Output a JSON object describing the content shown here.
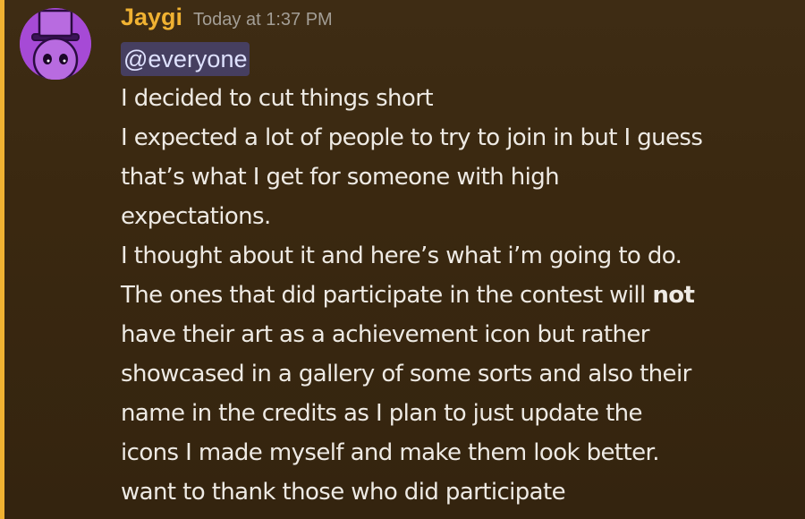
{
  "message": {
    "author": "Jaygi",
    "timestamp": "Today at 1:37 PM",
    "mention": "@everyone",
    "lines": [
      "I decided to cut things short",
      "I expected a lot of people to try to join in but I guess",
      "that’s what I get for someone with high",
      "expectations.",
      "I thought about it and here’s what i’m going to do.",
      "The ones that did participate in the contest will ",
      "not",
      "have their art as a achievement icon but rather",
      "showcased in a gallery of some sorts and also their",
      "name in the credits as I plan to just update the",
      "icons I made myself and make them look better.",
      "want to thank those who did participate"
    ]
  },
  "colors": {
    "author": "#f0b232",
    "accent_bar": "#f0b232",
    "avatar_bg": "#a64ad6",
    "mention_bg": "#5865f2"
  },
  "icons": {
    "avatar": "purple-top-hat-face-icon"
  }
}
